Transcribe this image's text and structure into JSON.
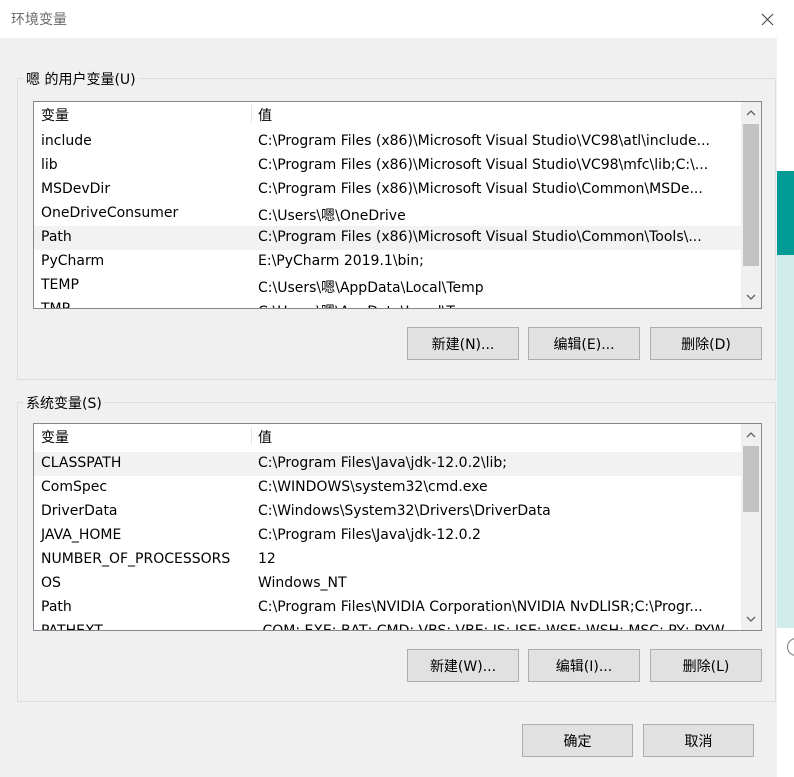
{
  "window": {
    "title": "环境变量",
    "close_icon": "close-icon"
  },
  "user_vars": {
    "label": "嗯 的用户变量(U)",
    "headers": {
      "name": "变量",
      "value": "值"
    },
    "rows": [
      {
        "name": "include",
        "value": "C:\\Program Files (x86)\\Microsoft Visual Studio\\VC98\\atl\\include..."
      },
      {
        "name": "lib",
        "value": "C:\\Program Files (x86)\\Microsoft Visual Studio\\VC98\\mfc\\lib;C:\\..."
      },
      {
        "name": "MSDevDir",
        "value": "C:\\Program Files (x86)\\Microsoft Visual Studio\\Common\\MSDe..."
      },
      {
        "name": "OneDriveConsumer",
        "value": "C:\\Users\\嗯\\OneDrive"
      },
      {
        "name": "Path",
        "value": "C:\\Program Files (x86)\\Microsoft Visual Studio\\Common\\Tools\\..."
      },
      {
        "name": "PyCharm",
        "value": "E:\\PyCharm 2019.1\\bin;"
      },
      {
        "name": "TEMP",
        "value": "C:\\Users\\嗯\\AppData\\Local\\Temp"
      },
      {
        "name": "TMP",
        "value": "C:\\Users\\嗯\\AppData\\Local\\Temp"
      }
    ],
    "buttons": {
      "new": "新建(N)...",
      "edit": "编辑(E)...",
      "delete": "删除(D)"
    }
  },
  "system_vars": {
    "label": "系统变量(S)",
    "headers": {
      "name": "变量",
      "value": "值"
    },
    "rows": [
      {
        "name": "CLASSPATH",
        "value": "C:\\Program Files\\Java\\jdk-12.0.2\\lib;"
      },
      {
        "name": "ComSpec",
        "value": "C:\\WINDOWS\\system32\\cmd.exe"
      },
      {
        "name": "DriverData",
        "value": "C:\\Windows\\System32\\Drivers\\DriverData"
      },
      {
        "name": "JAVA_HOME",
        "value": "C:\\Program Files\\Java\\jdk-12.0.2"
      },
      {
        "name": "NUMBER_OF_PROCESSORS",
        "value": "12"
      },
      {
        "name": "OS",
        "value": "Windows_NT"
      },
      {
        "name": "Path",
        "value": "C:\\Program Files\\NVIDIA Corporation\\NVIDIA NvDLISR;C:\\Progr..."
      },
      {
        "name": "PATHEXT",
        "value": ".COM;.EXE;.BAT;.CMD;.VBS;.VBE;.JS;.JSE;.WSF;.WSH;.MSC;.PY;.PYW"
      }
    ],
    "buttons": {
      "new": "新建(W)...",
      "edit": "编辑(I)...",
      "delete": "删除(L)"
    }
  },
  "footer": {
    "ok": "确定",
    "cancel": "取消"
  }
}
